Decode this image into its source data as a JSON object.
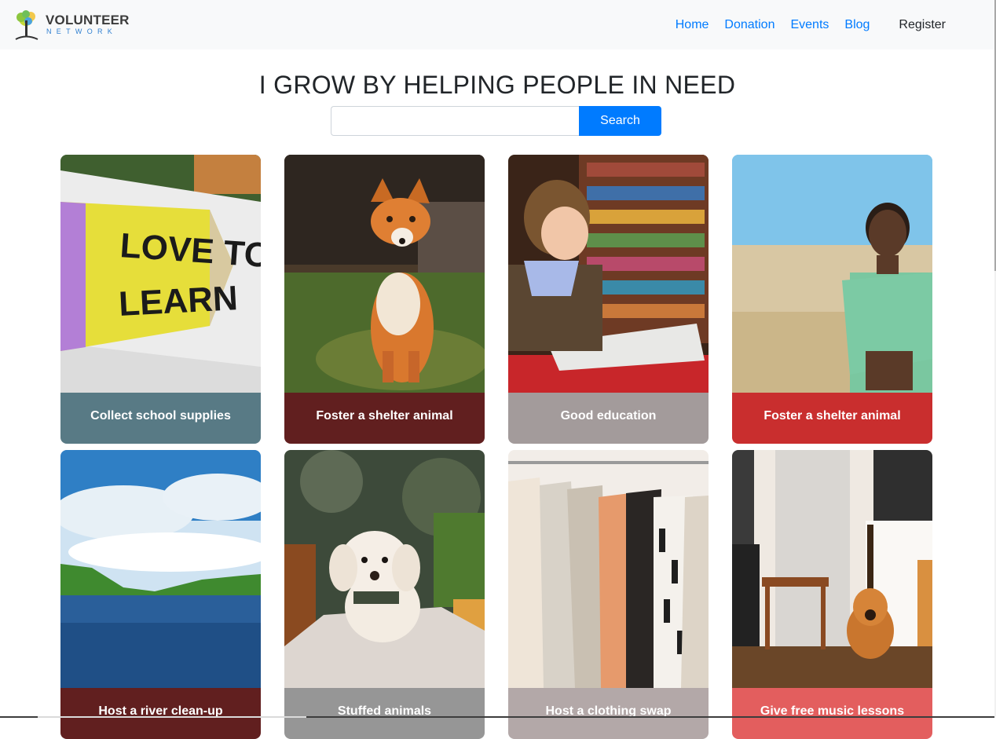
{
  "brand": {
    "name": "VOLUNTEER",
    "subtitle": "NETWORK"
  },
  "nav": {
    "items": [
      "Home",
      "Donation",
      "Events",
      "Blog"
    ],
    "register": "Register",
    "link_color": "#007bff"
  },
  "hero": {
    "title": "I GROW BY HELPING PEOPLE IN NEED"
  },
  "search": {
    "value": "",
    "placeholder": "",
    "button": "Search",
    "button_color": "#007bff"
  },
  "cards": [
    {
      "label": "Collect school supplies",
      "color": "#587a85",
      "image": "love-to-learn-pencil-sign"
    },
    {
      "label": "Foster a shelter animal",
      "color": "#611f1f",
      "image": "fox-sitting-in-grass"
    },
    {
      "label": "Good education",
      "color": "#a39b9b",
      "image": "boy-reading-in-library"
    },
    {
      "label": "Foster a shelter animal",
      "color": "#c92e2e",
      "image": "child-standing-in-field"
    },
    {
      "label": "Host a river clean-up",
      "color": "#611f1f",
      "image": "river-and-sky"
    },
    {
      "label": "Stuffed animals",
      "color": "#969696",
      "image": "poodle-dog"
    },
    {
      "label": "Host a clothing swap",
      "color": "#b3a8a8",
      "image": "clothes-on-rack"
    },
    {
      "label": "Give free music lessons",
      "color": "#e35e5e",
      "image": "guitar-in-room"
    }
  ]
}
